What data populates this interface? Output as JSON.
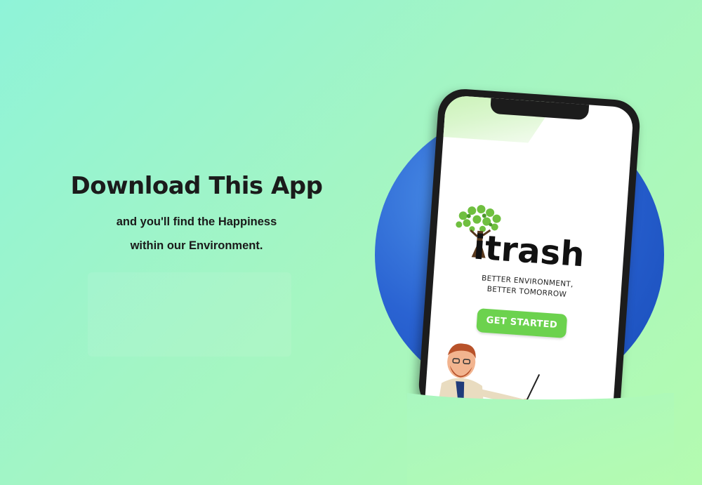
{
  "hero": {
    "headline": "Download This App",
    "subline_1": "and you'll find the Happiness",
    "subline_2": "within our Environment."
  },
  "app_screen": {
    "logo_text": "itrash",
    "tagline_1": "BETTER ENVIRONMENT,",
    "tagline_2": "BETTER TOMORROW",
    "cta_label": "GET STARTED"
  },
  "icons": {
    "logo": "tree-logo-icon",
    "mascot": "presenter-character-icon"
  },
  "colors": {
    "background_start": "#8ff3d8",
    "background_end": "#b4fbb0",
    "circle": "#2a63d2",
    "cta": "#6cd24e",
    "phone_frame": "#1c1c1c",
    "leaf": "#6fbf3f"
  }
}
